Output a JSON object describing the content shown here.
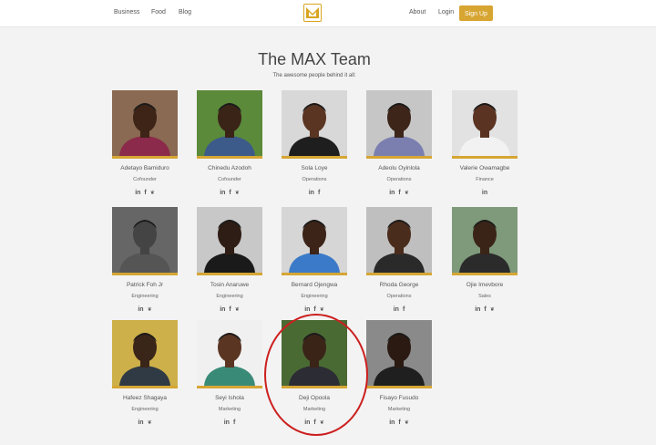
{
  "nav": {
    "left_links": [
      "Business",
      "Food",
      "Blog"
    ],
    "right_links": [
      "About",
      "Login"
    ],
    "signup_label": "Sign Up",
    "logo_icon": "max-logo-icon"
  },
  "header": {
    "title": "The MAX Team",
    "subtitle": "The awesome people behind it all:"
  },
  "colors": {
    "accent": "#d7a531",
    "highlight_circle": "#cc1f1f"
  },
  "team": [
    {
      "name": "Adetayo Bamiduro",
      "role": "Cofounder",
      "social": [
        "linkedin",
        "facebook",
        "twitter"
      ],
      "bg": "#8a6a52",
      "skin": "#3d2417",
      "shirt": "#8b2a4a"
    },
    {
      "name": "Chinedu Azodoh",
      "role": "Cofounder",
      "social": [
        "linkedin",
        "facebook",
        "twitter"
      ],
      "bg": "#5b8a3a",
      "skin": "#3a2418",
      "shirt": "#3c5a8a"
    },
    {
      "name": "Sola Loye",
      "role": "Operations",
      "social": [
        "linkedin",
        "facebook"
      ],
      "bg": "#d8d8d8",
      "skin": "#5a3522",
      "shirt": "#1e1e1e"
    },
    {
      "name": "Adeolu Oyinlola",
      "role": "Operations",
      "social": [
        "linkedin",
        "facebook",
        "twitter"
      ],
      "bg": "#c6c6c6",
      "skin": "#3d2519",
      "shirt": "#7a7fb0"
    },
    {
      "name": "Valerie Owamagbe",
      "role": "Finance",
      "social": [
        "linkedin"
      ],
      "bg": "#e2e2e2",
      "skin": "#5a3322",
      "shirt": "#f2f2f2"
    },
    {
      "name": "Patrick Foh Jr",
      "role": "Engineering",
      "social": [
        "linkedin",
        "twitter"
      ],
      "bg": "#666666",
      "skin": "#444444",
      "shirt": "#555555"
    },
    {
      "name": "Tosin Anaruwe",
      "role": "Engineering",
      "social": [
        "linkedin",
        "facebook",
        "twitter"
      ],
      "bg": "#c8c8c8",
      "skin": "#2e1d14",
      "shirt": "#1a1a1a"
    },
    {
      "name": "Bernard Ojengwa",
      "role": "Engineering",
      "social": [
        "linkedin",
        "facebook",
        "twitter"
      ],
      "bg": "#d6d6d6",
      "skin": "#3c2418",
      "shirt": "#3b7ac8"
    },
    {
      "name": "Rhoda George",
      "role": "Operations",
      "social": [
        "linkedin",
        "facebook"
      ],
      "bg": "#bfbfbf",
      "skin": "#4a2c1c",
      "shirt": "#2a2a2a"
    },
    {
      "name": "Ojie Imevbore",
      "role": "Sales",
      "social": [
        "linkedin",
        "facebook",
        "twitter"
      ],
      "bg": "#7e9a7a",
      "skin": "#3a2418",
      "shirt": "#2b2b2b"
    },
    {
      "name": "Hafeez Shagaya",
      "role": "Engineering",
      "social": [
        "linkedin",
        "twitter"
      ],
      "bg": "#cdb04a",
      "skin": "#3a2519",
      "shirt": "#2f3a44"
    },
    {
      "name": "Seyi Ishola",
      "role": "Marketing",
      "social": [
        "linkedin",
        "facebook"
      ],
      "bg": "#f0f0f0",
      "skin": "#5a3522",
      "shirt": "#3a8a78"
    },
    {
      "name": "Deji Opoola",
      "role": "Marketing",
      "social": [
        "linkedin",
        "facebook",
        "twitter"
      ],
      "bg": "#4a6a34",
      "skin": "#3a2418",
      "shirt": "#2c2c34"
    },
    {
      "name": "Fisayo Fusudo",
      "role": "Marketing",
      "social": [
        "linkedin",
        "facebook",
        "twitter"
      ],
      "bg": "#8a8a8a",
      "skin": "#2a1a12",
      "shirt": "#1f1f1f"
    }
  ]
}
